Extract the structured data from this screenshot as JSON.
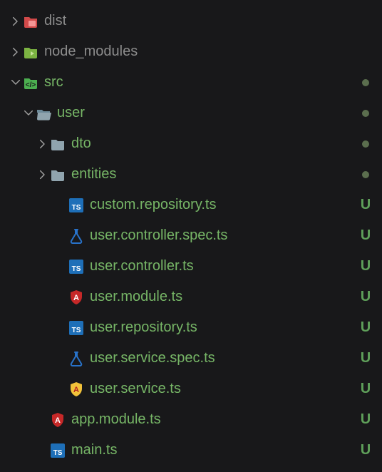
{
  "tree": [
    {
      "id": "dist",
      "label": "dist",
      "depth": 0,
      "kind": "folder",
      "icon": "folder-red",
      "chevron": "right",
      "text_class": "dim",
      "marker": ""
    },
    {
      "id": "node_modules",
      "label": "node_modules",
      "depth": 0,
      "kind": "folder",
      "icon": "folder-green",
      "chevron": "right",
      "text_class": "dim",
      "marker": ""
    },
    {
      "id": "src",
      "label": "src",
      "depth": 0,
      "kind": "folder",
      "icon": "folder-src",
      "chevron": "down",
      "text_class": "green",
      "marker": "dot"
    },
    {
      "id": "user",
      "label": "user",
      "depth": 1,
      "kind": "folder",
      "icon": "folder-open",
      "chevron": "down",
      "text_class": "green",
      "marker": "dot"
    },
    {
      "id": "dto",
      "label": "dto",
      "depth": 2,
      "kind": "folder",
      "icon": "folder-grey",
      "chevron": "right",
      "text_class": "green",
      "marker": "dot"
    },
    {
      "id": "entities",
      "label": "entities",
      "depth": 2,
      "kind": "folder",
      "icon": "folder-grey",
      "chevron": "right",
      "text_class": "green",
      "marker": "dot"
    },
    {
      "id": "custom-repository",
      "label": "custom.repository.ts",
      "depth": 3,
      "kind": "file",
      "icon": "ts",
      "chevron": "",
      "text_class": "green",
      "marker": "U"
    },
    {
      "id": "user-controller-spec",
      "label": "user.controller.spec.ts",
      "depth": 3,
      "kind": "file",
      "icon": "flask",
      "chevron": "",
      "text_class": "green",
      "marker": "U"
    },
    {
      "id": "user-controller",
      "label": "user.controller.ts",
      "depth": 3,
      "kind": "file",
      "icon": "ts",
      "chevron": "",
      "text_class": "green",
      "marker": "U"
    },
    {
      "id": "user-module",
      "label": "user.module.ts",
      "depth": 3,
      "kind": "file",
      "icon": "shield-red",
      "chevron": "",
      "text_class": "green",
      "marker": "U"
    },
    {
      "id": "user-repository",
      "label": "user.repository.ts",
      "depth": 3,
      "kind": "file",
      "icon": "ts",
      "chevron": "",
      "text_class": "green",
      "marker": "U"
    },
    {
      "id": "user-service-spec",
      "label": "user.service.spec.ts",
      "depth": 3,
      "kind": "file",
      "icon": "flask",
      "chevron": "",
      "text_class": "green",
      "marker": "U"
    },
    {
      "id": "user-service",
      "label": "user.service.ts",
      "depth": 3,
      "kind": "file",
      "icon": "shield-yellow",
      "chevron": "",
      "text_class": "green",
      "marker": "U"
    },
    {
      "id": "app-module",
      "label": "app.module.ts",
      "depth": 2,
      "kind": "file",
      "icon": "shield-red",
      "chevron": "",
      "text_class": "green",
      "marker": "U"
    },
    {
      "id": "main",
      "label": "main.ts",
      "depth": 2,
      "kind": "file",
      "icon": "ts",
      "chevron": "",
      "text_class": "green",
      "marker": "U"
    }
  ]
}
